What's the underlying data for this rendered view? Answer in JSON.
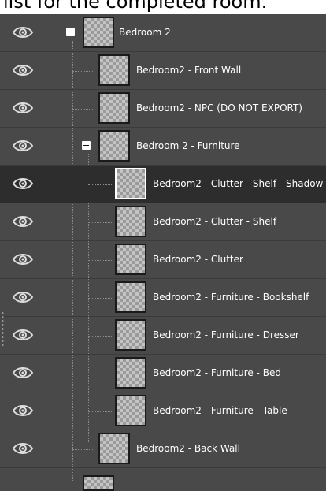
{
  "caption": "list for the completed room.",
  "layers": [
    {
      "label": "Bedroom 2",
      "depth": 0,
      "toggle": true
    },
    {
      "label": "Bedroom2 - Front Wall",
      "depth": 1
    },
    {
      "label": "Bedroom2 - NPC (DO NOT EXPORT)",
      "depth": 1
    },
    {
      "label": "Bedroom 2 - Furniture",
      "depth": 1,
      "toggle": true
    },
    {
      "label": "Bedroom2 - Clutter - Shelf - Shadow",
      "depth": 2,
      "selected": true
    },
    {
      "label": "Bedroom2 - Clutter - Shelf",
      "depth": 2
    },
    {
      "label": "Bedroom2 - Clutter",
      "depth": 2
    },
    {
      "label": "Bedroom2 - Furniture - Bookshelf",
      "depth": 2
    },
    {
      "label": "Bedroom2 - Furniture - Dresser",
      "depth": 2
    },
    {
      "label": "Bedroom2 - Furniture - Bed",
      "depth": 2
    },
    {
      "label": "Bedroom2 - Furniture - Table",
      "depth": 2
    },
    {
      "label": "Bedroom2 - Back Wall",
      "depth": 1
    }
  ],
  "icons": {
    "visibility": "eye-icon",
    "expand": "collapse-toggle-icon",
    "thumbnail": "layer-thumbnail"
  }
}
